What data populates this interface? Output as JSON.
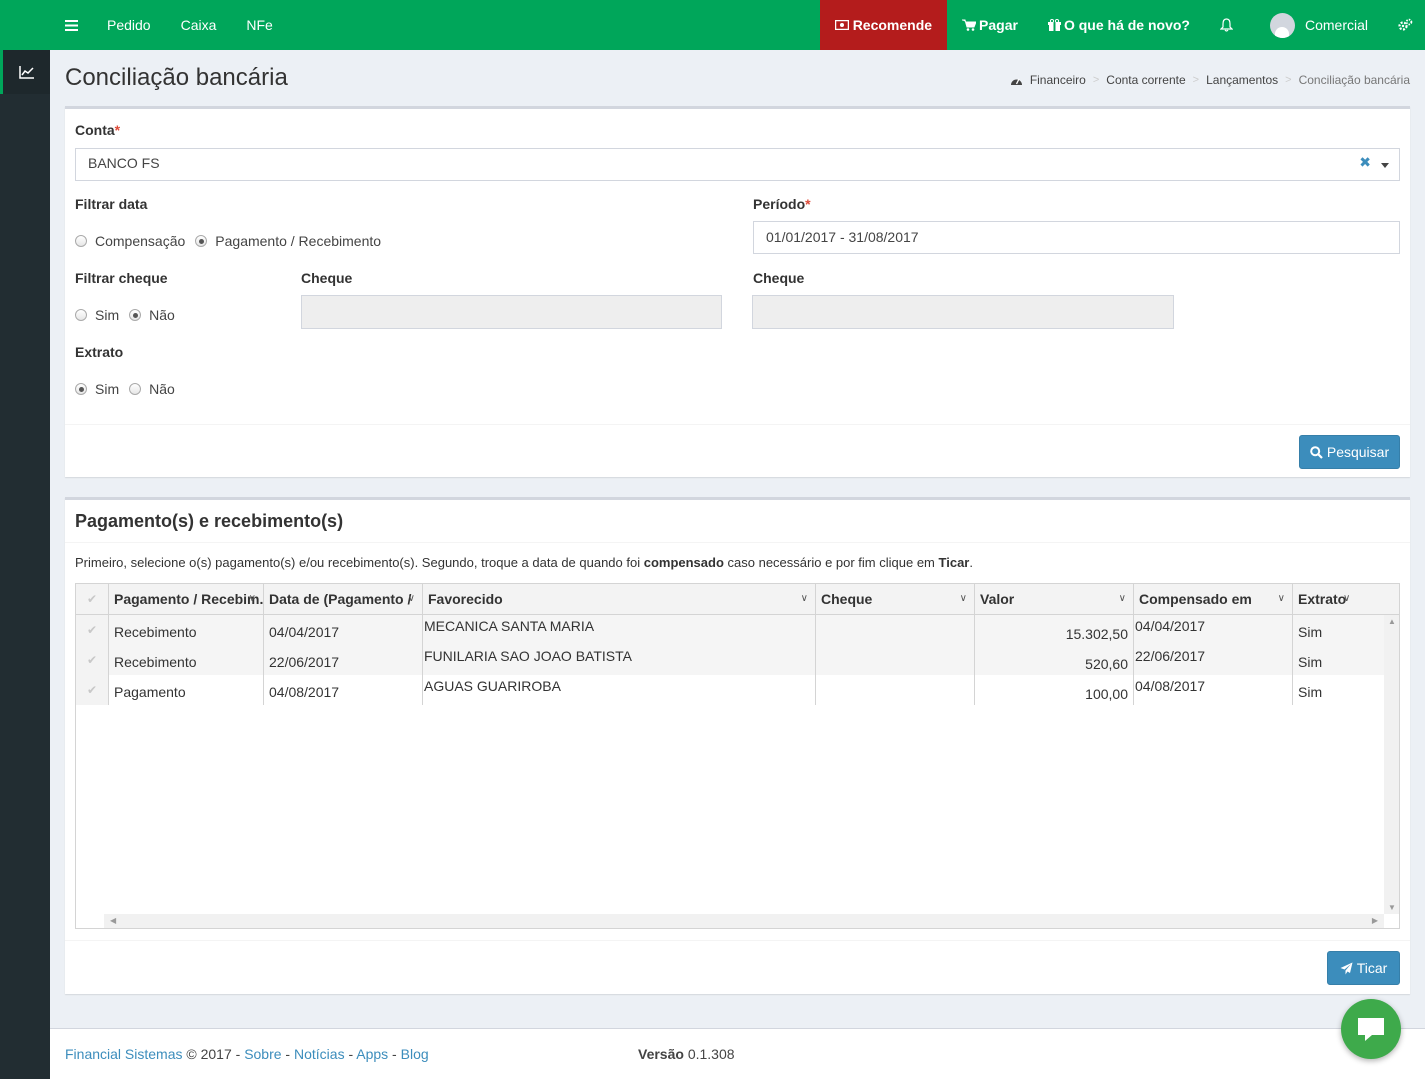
{
  "nav": {
    "links": [
      "Pedido",
      "Caixa",
      "NFe"
    ],
    "recommend": "Recomende",
    "pay": "Pagar",
    "whats_new": "O que há de novo?",
    "user": "Comercial"
  },
  "header": {
    "title": "Conciliação bancária",
    "breadcrumb": [
      "Financeiro",
      "Conta corrente",
      "Lançamentos",
      "Conciliação bancária"
    ]
  },
  "form": {
    "account_label": "Conta",
    "account_value": "BANCO FS",
    "filter_date_label": "Filtrar data",
    "filter_date_options": [
      "Compensação",
      "Pagamento / Recebimento"
    ],
    "period_label": "Período",
    "period_value": "01/01/2017 - 31/08/2017",
    "filter_check_label": "Filtrar cheque",
    "filter_check_options": [
      "Sim",
      "Não"
    ],
    "check_label_1": "Cheque",
    "check_label_2": "Cheque",
    "statement_label": "Extrato",
    "statement_options": [
      "Sim",
      "Não"
    ],
    "search_button": "Pesquisar"
  },
  "results": {
    "title": "Pagamento(s) e recebimento(s)",
    "hint_1": "Primeiro, selecione o(s) pagamento(s) e/ou recebimento(s). Segundo, troque a data de quando foi ",
    "hint_bold_1": "compensado",
    "hint_2": " caso necessário e por fim clique em ",
    "hint_bold_2": "Ticar",
    "hint_3": ".",
    "columns": [
      "Pagamento / Recebim.",
      "Data de (Pagamento /",
      "Favorecido",
      "Cheque",
      "Valor",
      "Compensado em",
      "Extrato"
    ],
    "rows": [
      [
        "Recebimento",
        "04/04/2017",
        "MECANICA SANTA MARIA",
        "",
        "15.302,50",
        "04/04/2017",
        "Sim"
      ],
      [
        "Recebimento",
        "22/06/2017",
        "FUNILARIA SAO JOAO BATISTA",
        "",
        "520,60",
        "22/06/2017",
        "Sim"
      ],
      [
        "Pagamento",
        "04/08/2017",
        "AGUAS GUARIROBA",
        "",
        "100,00",
        "04/08/2017",
        "Sim"
      ]
    ],
    "tick_button": "Ticar"
  },
  "footer": {
    "company": "Financial Sistemas",
    "copyright": " © 2017 - ",
    "links": [
      "Sobre",
      "Notícias",
      "Apps",
      "Blog"
    ],
    "version_label": "Versão",
    "version": "0.1.308"
  },
  "colors": {
    "brand": "#00a65a",
    "recommend": "#b41c1c",
    "primary": "#3c8dbc",
    "chat": "#3eaa4b"
  }
}
